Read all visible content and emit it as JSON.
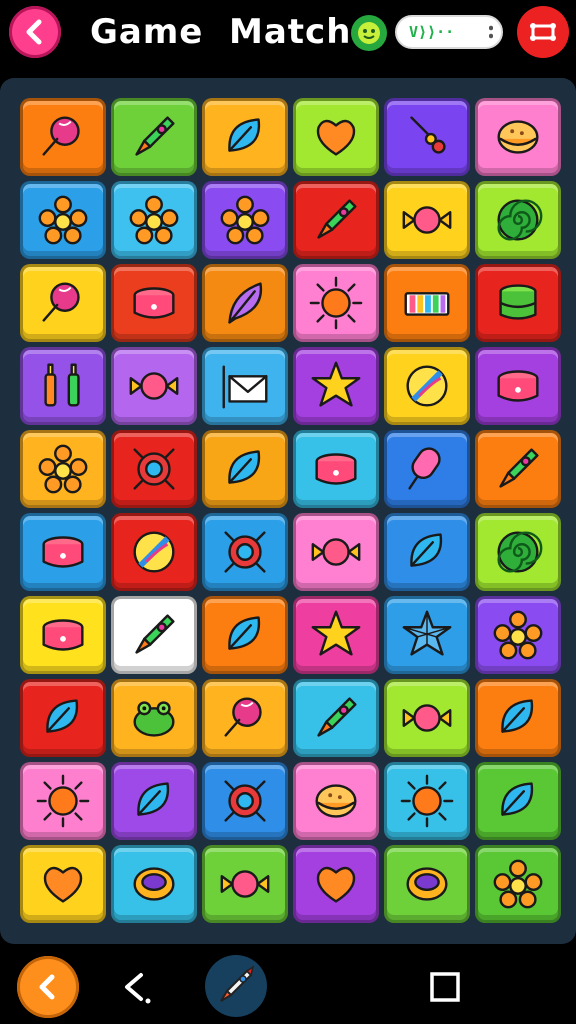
{
  "header": {
    "title": "Game  Match",
    "status_text": "V⟩⟩··",
    "icons": {
      "back": "chevron-left-icon",
      "status": "face-icon",
      "menu": "swap-icon"
    }
  },
  "board": {
    "rows": 10,
    "cols": 6,
    "tiles": [
      {
        "color": "#fd7e10",
        "icon": "lollipop-icon"
      },
      {
        "color": "#6ed13a",
        "icon": "rocket-icon"
      },
      {
        "color": "#ffb31f",
        "icon": "leaf-icon"
      },
      {
        "color": "#a2e830",
        "icon": "heart-icon"
      },
      {
        "color": "#7a45f0",
        "icon": "wand-icon"
      },
      {
        "color": "#ff7fcf",
        "icon": "cookie-icon"
      },
      {
        "color": "#2b9fe8",
        "icon": "flower-icon"
      },
      {
        "color": "#3fc1f0",
        "icon": "flower-icon"
      },
      {
        "color": "#8a4cf0",
        "icon": "flower-icon"
      },
      {
        "color": "#e8241e",
        "icon": "rocket-icon"
      },
      {
        "color": "#ffd21e",
        "icon": "candy-icon"
      },
      {
        "color": "#a2e830",
        "icon": "spiral-icon"
      },
      {
        "color": "#ffd21e",
        "icon": "lollipop-icon"
      },
      {
        "color": "#ea3e1e",
        "icon": "pot-icon"
      },
      {
        "color": "#f58a12",
        "icon": "feather-icon"
      },
      {
        "color": "#ff7fd1",
        "icon": "sun-icon"
      },
      {
        "color": "#fd7e10",
        "icon": "xylophone-icon"
      },
      {
        "color": "#e8241e",
        "icon": "drum-icon"
      },
      {
        "color": "#9452e8",
        "icon": "bottles-icon"
      },
      {
        "color": "#b466ef",
        "icon": "candy-icon"
      },
      {
        "color": "#3fb3ee",
        "icon": "envelope-icon"
      },
      {
        "color": "#a43fe0",
        "icon": "star-icon"
      },
      {
        "color": "#ffd21e",
        "icon": "ball-icon"
      },
      {
        "color": "#a43fe0",
        "icon": "pot-icon"
      },
      {
        "color": "#ffb31f",
        "icon": "flower-icon"
      },
      {
        "color": "#e8241e",
        "icon": "gem-icon"
      },
      {
        "color": "#f8a516",
        "icon": "leaf-icon"
      },
      {
        "color": "#37c0e8",
        "icon": "pot-icon"
      },
      {
        "color": "#2f7ee8",
        "icon": "popsicle-icon"
      },
      {
        "color": "#fd7e10",
        "icon": "rocket-icon"
      },
      {
        "color": "#2b9fe8",
        "icon": "pot-icon"
      },
      {
        "color": "#e8241e",
        "icon": "ball-icon"
      },
      {
        "color": "#2b9fe8",
        "icon": "gem-icon"
      },
      {
        "color": "#ff7fd1",
        "icon": "candy-icon"
      },
      {
        "color": "#2f8ee8",
        "icon": "leaf-icon"
      },
      {
        "color": "#a2e830",
        "icon": "spiral-icon"
      },
      {
        "color": "#ffe11e",
        "icon": "pot-icon"
      },
      {
        "color": "#ffffff",
        "icon": "rocket-icon"
      },
      {
        "color": "#fd7e10",
        "icon": "leaf-icon"
      },
      {
        "color": "#ee3fa0",
        "icon": "star-icon"
      },
      {
        "color": "#2f9ee8",
        "icon": "crystal-icon"
      },
      {
        "color": "#8a4cf0",
        "icon": "flower-icon"
      },
      {
        "color": "#e8241e",
        "icon": "leaf-icon"
      },
      {
        "color": "#ffb31f",
        "icon": "frog-icon"
      },
      {
        "color": "#ffb31f",
        "icon": "lollipop-icon"
      },
      {
        "color": "#37c0e8",
        "icon": "rocket-icon"
      },
      {
        "color": "#a2e830",
        "icon": "candy-icon"
      },
      {
        "color": "#fd7e10",
        "icon": "leaf-icon"
      },
      {
        "color": "#ff7fcf",
        "icon": "sun-icon"
      },
      {
        "color": "#9e4ae8",
        "icon": "leaf-icon"
      },
      {
        "color": "#2f8ee8",
        "icon": "gem-icon"
      },
      {
        "color": "#ff7fd1",
        "icon": "cookie-icon"
      },
      {
        "color": "#37c0e8",
        "icon": "sun-icon"
      },
      {
        "color": "#5ac834",
        "icon": "leaf-icon"
      },
      {
        "color": "#ffd21e",
        "icon": "heart-icon"
      },
      {
        "color": "#37c0e8",
        "icon": "ring-icon"
      },
      {
        "color": "#6ed13a",
        "icon": "candy-icon"
      },
      {
        "color": "#a43fe0",
        "icon": "heart-icon"
      },
      {
        "color": "#6ed13a",
        "icon": "ring-icon"
      },
      {
        "color": "#5ac834",
        "icon": "flower-icon"
      }
    ]
  },
  "bottom_nav": {
    "icons": {
      "back": "chevron-left-icon",
      "chevron": "chevron-left-icon",
      "game": "rocket-icon",
      "recents": "square-icon"
    }
  }
}
